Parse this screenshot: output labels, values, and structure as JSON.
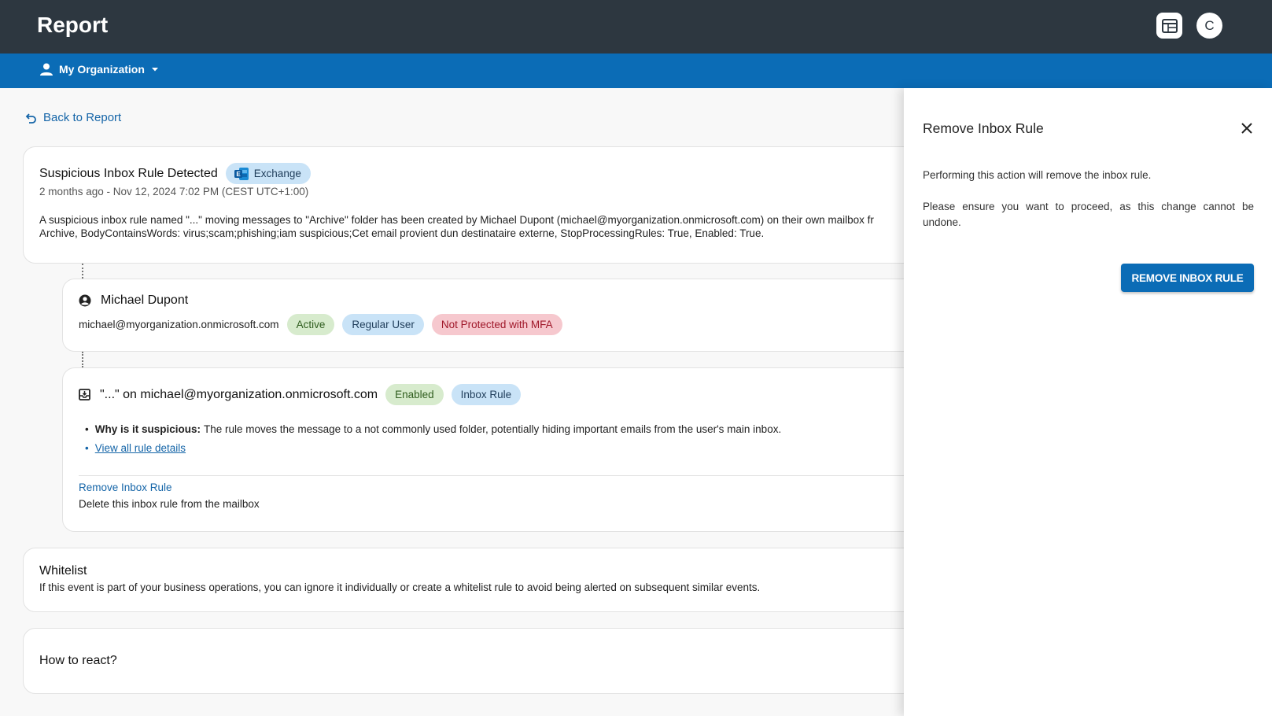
{
  "header": {
    "title": "Report",
    "avatar_initial": "C",
    "icons": [
      "calendar-table-icon"
    ]
  },
  "org_bar": {
    "label": "My Organization",
    "icons": [
      "person-icon",
      "caret-down-icon"
    ]
  },
  "back_link": "Back to Report",
  "alert": {
    "title": "Suspicious Inbox Rule Detected",
    "source_badge": "Exchange",
    "timestamp": "2 months ago - Nov 12, 2024 7:02 PM (CEST UTC+1:00)",
    "description_line1": "A suspicious inbox rule named \"...\" moving messages to \"Archive\" folder has been created by Michael Dupont (michael@myorganization.onmicrosoft.com) on their own mailbox fr",
    "description_line2": "Archive, BodyContainsWords: virus;scam;phishing;iam suspicious;Cet email provient dun destinataire externe, StopProcessingRules: True, Enabled: True."
  },
  "user_card": {
    "name": "Michael Dupont",
    "email": "michael@myorganization.onmicrosoft.com",
    "badges": [
      "Active",
      "Regular User",
      "Not Protected with MFA"
    ]
  },
  "rule_card": {
    "title": "\"...\" on michael@myorganization.onmicrosoft.com",
    "badges": [
      "Enabled",
      "Inbox Rule"
    ],
    "why_label": "Why is it suspicious:",
    "why_text": "The rule moves the message to a not commonly used folder, potentially hiding important emails from the user's main inbox.",
    "details_link": "View all rule details",
    "action_title": "Remove Inbox Rule",
    "action_desc": "Delete this inbox rule from the mailbox"
  },
  "whitelist": {
    "title": "Whitelist",
    "text": "If this event is part of your business operations, you can ignore it individually or create a whitelist rule to avoid being alerted on subsequent similar events."
  },
  "how_to_react": {
    "title": "How to react?"
  },
  "panel": {
    "title": "Remove Inbox Rule",
    "text1": "Performing this action will remove the inbox rule.",
    "text2": "Please ensure you want to proceed, as this change cannot be undone.",
    "button": "REMOVE INBOX RULE"
  },
  "colors": {
    "topbar": "#2d3740",
    "orgbar": "#0b6cb6",
    "link": "#1565a8",
    "chip_blue": "#c9e3f7",
    "chip_green": "#d7ebcd",
    "chip_red": "#f6c8ce"
  }
}
